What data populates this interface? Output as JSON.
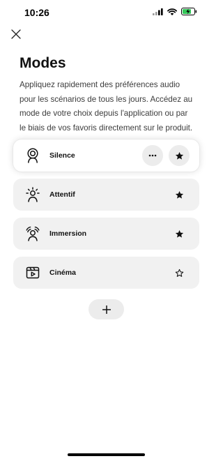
{
  "status_bar": {
    "time": "10:26",
    "icons": [
      "signal-icon",
      "wifi-icon",
      "battery-charging-icon"
    ],
    "battery_color": "#34c759"
  },
  "header": {
    "close_icon": "close-icon",
    "title": "Modes"
  },
  "description": "Appliquez rapidement des préférences audio pour les scénarios de tous les jours. Accédez au mode de votre choix depuis l'application ou par le biais de vos favoris directement sur le produit.",
  "modes": [
    {
      "label": "Silence",
      "icon": "silence-mode-icon",
      "favorite": true,
      "active": true
    },
    {
      "label": "Attentif",
      "icon": "aware-mode-icon",
      "favorite": true,
      "active": false
    },
    {
      "label": "Immersion",
      "icon": "immersion-mode-icon",
      "favorite": true,
      "active": false
    },
    {
      "label": "Cinéma",
      "icon": "cinema-mode-icon",
      "favorite": false,
      "active": false
    }
  ],
  "add_button": {
    "icon": "plus-icon"
  }
}
